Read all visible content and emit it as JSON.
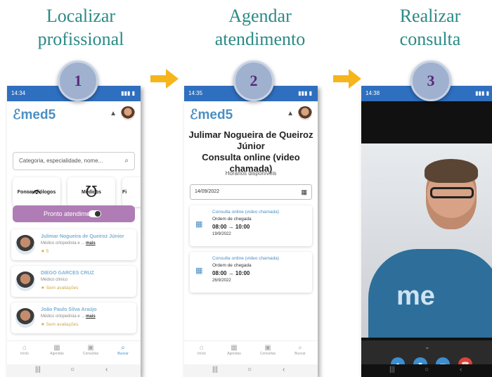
{
  "steps": [
    {
      "title_l1": "Localizar",
      "title_l2": "profissional",
      "number": "1"
    },
    {
      "title_l1": "Agendar",
      "title_l2": "atendimento",
      "number": "2"
    },
    {
      "title_l1": "Realizar",
      "title_l2": "consulta",
      "number": "3"
    }
  ],
  "colors": {
    "title": "#2a8a86",
    "arrow": "#f5b51b",
    "brand": "#4a8fc4",
    "pronto": "#b07cb5",
    "status_bar": "#2f6fbf"
  },
  "phone1": {
    "status_time": "14:34",
    "logo": "med5",
    "search_placeholder": "Categoria, especialidade, nome...",
    "categories": [
      {
        "label": "Fonoaudiólogos",
        "icon": "ear-icon"
      },
      {
        "label": "Médicos",
        "icon": "stethoscope-icon"
      },
      {
        "label": "Fi",
        "icon": "partial-icon"
      }
    ],
    "pronto_label": "Pronto atendimento",
    "professionals": [
      {
        "name": "Julimar Nogueira de Queiroz Júnior",
        "specialty": "Médico ortopedista e ...",
        "more": "mais",
        "rating": "★ 5"
      },
      {
        "name": "DIEGO GARCES CRUZ",
        "specialty": "Médico clínico",
        "more": "",
        "rating": "★ Sem avaliações"
      },
      {
        "name": "João Paulo Silva Araújo",
        "specialty": "Médico ortopedista e ...",
        "more": "mais",
        "rating": "★ Sem avaliações"
      }
    ],
    "nav": [
      "Início",
      "Agendas",
      "Consultas",
      "Buscar"
    ]
  },
  "phone2": {
    "status_time": "14:35",
    "logo": "med5",
    "doctor_name": "Julimar Nogueira de Queiroz Júnior",
    "consult_type": "Consulta online (video chamada)",
    "subtitle": "Horários disponíveis",
    "date": "14/09/2022",
    "slots": [
      {
        "type": "Consulta online (video chamada)",
        "order": "Ordem de chegada",
        "time": "08:00 → 10:00",
        "date": "19/9/2022"
      },
      {
        "type": "Consulta online (video chamada)",
        "order": "Ordem de chegada",
        "time": "08:00 → 10:00",
        "date": "26/9/2022"
      }
    ],
    "nav": [
      "Início",
      "Agendas",
      "Consultas",
      "Buscar"
    ]
  },
  "phone3": {
    "status_time": "14:38",
    "shirt_text": "me"
  }
}
